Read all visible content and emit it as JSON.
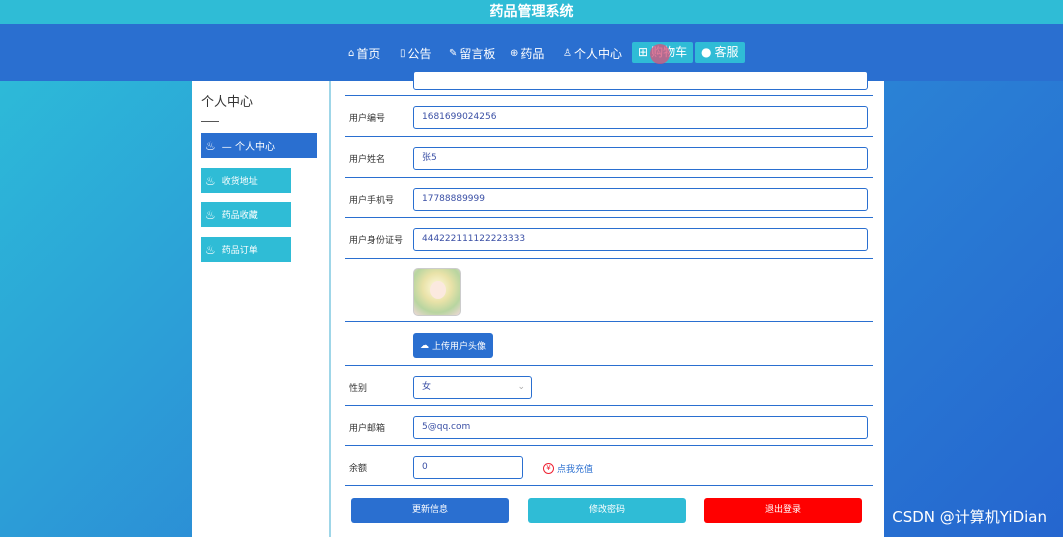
{
  "app": {
    "title": "药品管理系统"
  },
  "nav": {
    "items": [
      {
        "icon": "home-icon",
        "glyph": "⌂",
        "label": "首页"
      },
      {
        "icon": "notice-icon",
        "glyph": "▯",
        "label": "公告"
      },
      {
        "icon": "message-icon",
        "glyph": "✎",
        "label": "留言板"
      },
      {
        "icon": "medicine-icon",
        "glyph": "⊕",
        "label": "药品"
      },
      {
        "icon": "user-icon",
        "glyph": "♙",
        "label": "个人中心"
      }
    ],
    "cart": {
      "icon": "cart-icon",
      "glyph": "⊞",
      "label": "购物车"
    },
    "service": {
      "icon": "service-icon",
      "glyph": "●",
      "label": "客服"
    }
  },
  "sidebar": {
    "title": "个人中心",
    "items": [
      {
        "label": "— 个人中心",
        "icon": "fire-icon"
      },
      {
        "label": "收货地址",
        "icon": "fire-icon"
      },
      {
        "label": "药品收藏",
        "icon": "fire-icon"
      },
      {
        "label": "药品订单",
        "icon": "fire-icon"
      }
    ]
  },
  "form": {
    "user_no": {
      "label": "用户编号",
      "value": "1681699024256"
    },
    "user_name": {
      "label": "用户姓名",
      "value": "张5"
    },
    "phone": {
      "label": "用户手机号",
      "value": "17788889999"
    },
    "id_card": {
      "label": "用户身份证号",
      "value": "444222111122223333"
    },
    "upload_label": "上传用户头像",
    "gender": {
      "label": "性别",
      "value": "女"
    },
    "email": {
      "label": "用户邮箱",
      "value": "5@qq.com"
    },
    "balance": {
      "label": "余额",
      "value": "0",
      "recharge": "点我充值"
    }
  },
  "actions": {
    "update": "更新信息",
    "password": "修改密码",
    "logout": "退出登录"
  },
  "colors": {
    "primary": "#2a6fd0",
    "accent": "#2fbcd6",
    "danger": "#ff0000"
  },
  "watermark": "CSDN @计算机YiDian"
}
